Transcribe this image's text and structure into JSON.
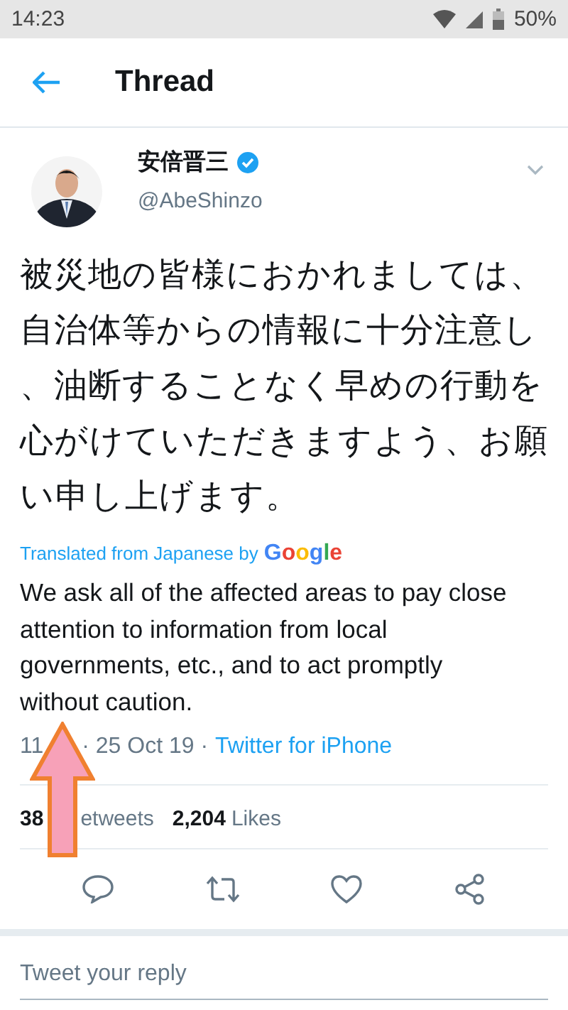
{
  "status_bar": {
    "time": "14:23",
    "battery": "50%"
  },
  "header": {
    "title": "Thread"
  },
  "tweet": {
    "author": "安倍晋三",
    "verified": true,
    "handle": "@AbeShinzo",
    "text": "被災地の皆様におかれましては、自治体等からの情報に十分注意し、油断することなく早めの行動を心がけていただきますよう、お願い申し上げます。",
    "translation_label": "Translated from Japanese by",
    "translation_brand": "Google",
    "translation": "We ask all of the affected areas to pay close attention to information from local governments, etc., and to act promptly without caution.",
    "time": "11",
    "date": "· 25 Oct 19 ·",
    "source": "Twitter for iPhone"
  },
  "stats": {
    "retweets_count": "38",
    "retweets_label": "etweets",
    "likes_count": "2,204",
    "likes_label": "Likes"
  },
  "reply": {
    "placeholder": "Tweet your reply"
  }
}
